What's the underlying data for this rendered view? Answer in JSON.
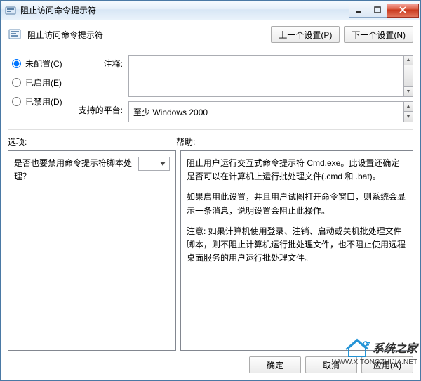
{
  "window": {
    "title": "阻止访问命令提示符"
  },
  "header": {
    "title": "阻止访问命令提示符",
    "prev": "上一个设置(P)",
    "next": "下一个设置(N)"
  },
  "radios": {
    "not_configured": "未配置(C)",
    "enabled": "已启用(E)",
    "disabled": "已禁用(D)"
  },
  "labels": {
    "comment": "注释:",
    "supported": "支持的平台:",
    "options": "选项:",
    "help": "帮助:"
  },
  "values": {
    "comment": "",
    "supported": "至少 Windows 2000",
    "option_question": "是否也要禁用命令提示符脚本处理？"
  },
  "help": {
    "p1": "阻止用户运行交互式命令提示符 Cmd.exe。此设置还确定是否可以在计算机上运行批处理文件(.cmd 和 .bat)。",
    "p2": "如果启用此设置，并且用户试图打开命令窗口，则系统会显示一条消息，说明设置会阻止此操作。",
    "p3": "注意: 如果计算机使用登录、注销、启动或关机批处理文件脚本，则不阻止计算机运行批处理文件，也不阻止使用远程桌面服务的用户运行批处理文件。"
  },
  "footer": {
    "ok": "确定",
    "cancel": "取消",
    "apply": "应用(A)"
  },
  "watermark": {
    "brand": "系统之家",
    "url": "WWW.XITONGZHIJIA.NET"
  }
}
